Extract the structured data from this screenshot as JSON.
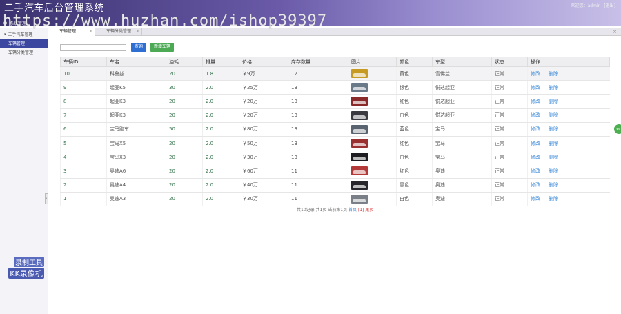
{
  "header": {
    "title": "二手汽车后台管理系统",
    "user_greeting": "欢迎您：admin",
    "logout": "[退出]",
    "watermark": "https://www.huzhan.com/ishop39397"
  },
  "topnav": {
    "home_label": "系统管理"
  },
  "sidebar": {
    "group": "二手汽车管理",
    "items": [
      {
        "label": "车辆管理",
        "active": true
      },
      {
        "label": "车辆分类管理",
        "active": false
      }
    ],
    "recorder_line1": "录制工具",
    "recorder_line2": "KK录像机"
  },
  "tabs": [
    {
      "label": "车辆管理",
      "active": true
    },
    {
      "label": "车辆分类管理",
      "active": false
    }
  ],
  "toolbar": {
    "search_value": "",
    "search_placeholder": "",
    "query_label": "查询",
    "add_label": "新增车辆"
  },
  "table": {
    "headers": [
      "车辆ID",
      "车名",
      "油耗",
      "排量",
      "价格",
      "库存数量",
      "图片",
      "颜色",
      "车型",
      "状态",
      "操作"
    ],
    "rows": [
      {
        "id": "10",
        "name": "科鲁兹",
        "fuel": "20",
        "disp": "1.8",
        "price": "￥9万",
        "stock": "12",
        "img": "#c79a22",
        "color": "黄色",
        "model": "雪佛兰",
        "status": "正常"
      },
      {
        "id": "9",
        "name": "起亚K5",
        "fuel": "30",
        "disp": "2.0",
        "price": "￥25万",
        "stock": "13",
        "img": "#6b7a88",
        "color": "银色",
        "model": "悦达起亚",
        "status": "正常"
      },
      {
        "id": "8",
        "name": "起亚K3",
        "fuel": "20",
        "disp": "2.0",
        "price": "￥20万",
        "stock": "13",
        "img": "#8a2a2a",
        "color": "红色",
        "model": "悦达起亚",
        "status": "正常"
      },
      {
        "id": "7",
        "name": "起亚K3",
        "fuel": "20",
        "disp": "2.0",
        "price": "￥20万",
        "stock": "13",
        "img": "#3a3a40",
        "color": "白色",
        "model": "悦达起亚",
        "status": "正常"
      },
      {
        "id": "6",
        "name": "宝马跑车",
        "fuel": "50",
        "disp": "2.0",
        "price": "￥80万",
        "stock": "13",
        "img": "#5a6470",
        "color": "蓝色",
        "model": "宝马",
        "status": "正常"
      },
      {
        "id": "5",
        "name": "宝马X5",
        "fuel": "20",
        "disp": "2.0",
        "price": "￥50万",
        "stock": "13",
        "img": "#9a3030",
        "color": "红色",
        "model": "宝马",
        "status": "正常"
      },
      {
        "id": "4",
        "name": "宝马X3",
        "fuel": "20",
        "disp": "2.0",
        "price": "￥30万",
        "stock": "13",
        "img": "#1e1e22",
        "color": "白色",
        "model": "宝马",
        "status": "正常"
      },
      {
        "id": "3",
        "name": "奥迪A6",
        "fuel": "20",
        "disp": "2.0",
        "price": "￥60万",
        "stock": "11",
        "img": "#b33a38",
        "color": "红色",
        "model": "奥迪",
        "status": "正常"
      },
      {
        "id": "2",
        "name": "奥迪A4",
        "fuel": "20",
        "disp": "2.0",
        "price": "￥40万",
        "stock": "11",
        "img": "#26262b",
        "color": "黑色",
        "model": "奥迪",
        "status": "正常"
      },
      {
        "id": "1",
        "name": "奥迪A3",
        "fuel": "20",
        "disp": "2.0",
        "price": "￥30万",
        "stock": "11",
        "img": "#7a7f88",
        "color": "白色",
        "model": "奥迪",
        "status": "正常"
      }
    ],
    "edit_label": "修改",
    "delete_label": "删除"
  },
  "pager": {
    "summary": "共10记录 共1页 当前第1页",
    "first": "首页",
    "current": "[1]",
    "last": "尾页"
  },
  "colors": {
    "header_start": "#3a3270",
    "query_btn": "#2f6fd1",
    "add_btn": "#4caa55",
    "link": "#3b8ad9"
  }
}
